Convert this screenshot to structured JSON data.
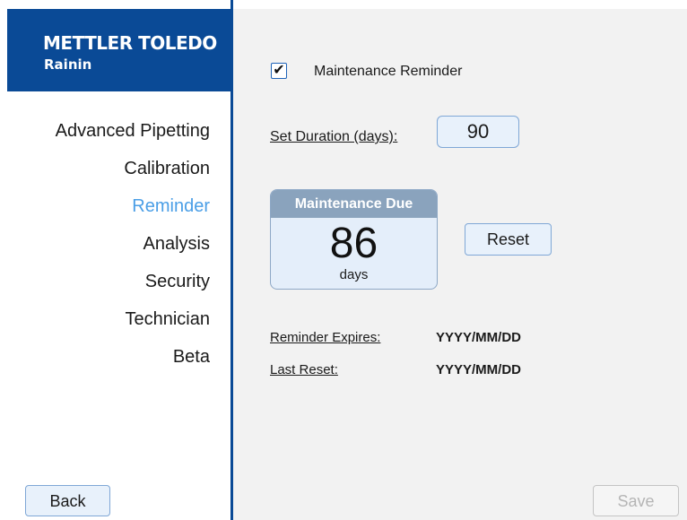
{
  "brand": {
    "line1": "METTLER TOLEDO",
    "line2": "Rainin",
    "color": "#0a4a96"
  },
  "sidebar": {
    "items": [
      {
        "label": "Advanced Pipetting",
        "active": false
      },
      {
        "label": "Calibration",
        "active": false
      },
      {
        "label": "Reminder",
        "active": true
      },
      {
        "label": "Analysis",
        "active": false
      },
      {
        "label": "Security",
        "active": false
      },
      {
        "label": "Technician",
        "active": false
      },
      {
        "label": "Beta",
        "active": false
      }
    ],
    "active_color": "#4a9ee6",
    "back_label": "Back"
  },
  "reminder": {
    "checkbox_label": "Maintenance Reminder",
    "checkbox_checked": true,
    "checkbox_mark": "✔",
    "duration_label": "Set Duration (days):",
    "duration_value": "90",
    "due_card": {
      "title": "Maintenance Due",
      "value": "86",
      "unit": "days"
    },
    "reset_label": "Reset",
    "expires_label": "Reminder Expires:",
    "expires_value": "YYYY/MM/DD",
    "last_reset_label": "Last Reset:",
    "last_reset_value": "YYYY/MM/DD",
    "save_label": "Save",
    "save_enabled": false
  }
}
